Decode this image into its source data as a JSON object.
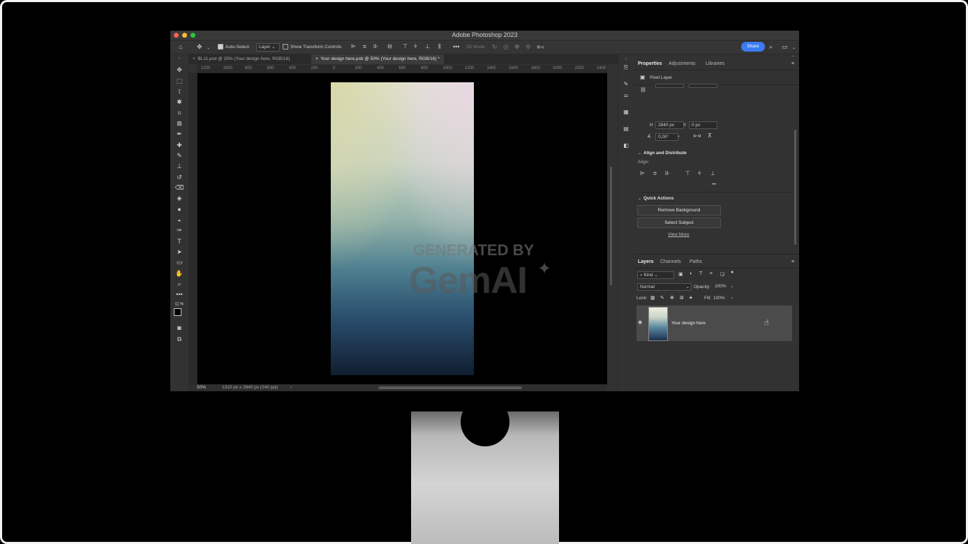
{
  "app": {
    "title": "Adobe Photoshop 2023"
  },
  "options_bar": {
    "auto_select_label": "Auto-Select:",
    "auto_select_value": "Layer",
    "transform_controls_label": "Show Transform Controls",
    "mode_3d_label": "3D Mode:",
    "share_label": "Share"
  },
  "tabs": [
    {
      "label": "BL11.psd @ 25% (Your design here, RGB/16)",
      "active": false
    },
    {
      "label": "Your design here.psb @ 50% (Your design here, RGB/16) *",
      "active": true
    }
  ],
  "ruler_top": [
    "1200",
    "1000",
    "800",
    "600",
    "400",
    "200",
    "0",
    "200",
    "400",
    "600",
    "800",
    "1000",
    "1200",
    "1400",
    "1600",
    "1800",
    "2000",
    "2200",
    "2400"
  ],
  "status": {
    "zoom": "50%",
    "doc_info": "1310 px x 2840 px (240 ppi)",
    "arrow": "›"
  },
  "watermark": {
    "line1": "GENERATED BY",
    "line2": "GemAI",
    "spark": "✦"
  },
  "properties": {
    "tabs": [
      "Properties",
      "Adjustments",
      "Libraries"
    ],
    "active_tab": "Properties",
    "layer_type": "Pixel Layer",
    "h_label": "H",
    "h_value": "2840 px",
    "y_label": "Y",
    "y_value": "0 px",
    "angle_value": "0,00°",
    "align_section": "Align and Distribute",
    "align_label": "Align:",
    "quick_actions_section": "Quick Actions",
    "remove_bg_label": "Remove Background",
    "select_subject_label": "Select Subject",
    "view_more_label": "View More",
    "more_dots": "•••"
  },
  "layers": {
    "tabs": [
      "Layers",
      "Channels",
      "Paths"
    ],
    "active_tab": "Layers",
    "filter_kind": "Kind",
    "blend_mode": "Normal",
    "opacity_label": "Opacity:",
    "opacity_value": "100%",
    "lock_label": "Lock:",
    "fill_label": "Fill:",
    "fill_value": "100%",
    "items": [
      {
        "name": "Your design here",
        "visible": true
      }
    ]
  },
  "colors": {
    "accent": "#3c7bf0",
    "panel_bg": "#323232",
    "canvas_bg": "#000000"
  }
}
